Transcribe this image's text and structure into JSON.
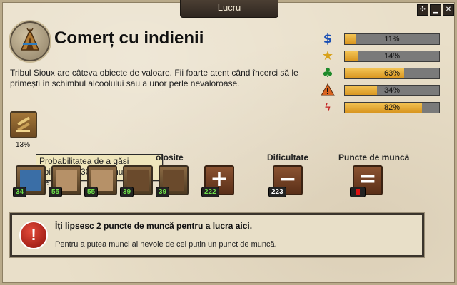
{
  "window": {
    "title": "Lucru",
    "buttons": [
      "✣",
      "▁",
      "✕"
    ]
  },
  "header": {
    "title": "Comerț cu indienii",
    "icon": "teepee-icon"
  },
  "description": "Tribul Sioux are câteva obiecte de valoare. Fii foarte atent când încerci să le primești în schimbul alcoolului sau a unor perle nevaloroase.",
  "stats": [
    {
      "name": "wages",
      "icon": "dollar-icon",
      "color": "#1a4fb4",
      "percent": "11%",
      "fill": 0.11
    },
    {
      "name": "experience",
      "icon": "star-icon",
      "color": "#d8a21c",
      "percent": "14%",
      "fill": 0.14
    },
    {
      "name": "luck",
      "icon": "clover-icon",
      "color": "#1e8a2a",
      "percent": "63%",
      "fill": 0.63
    },
    {
      "name": "danger",
      "icon": "warning-icon",
      "color": "#c2541c",
      "percent": "34%",
      "fill": 0.34
    },
    {
      "name": "motivation",
      "icon": "motivation-icon",
      "color": "#c21c1c",
      "percent": "82%",
      "fill": 0.82
    }
  ],
  "drop": {
    "cursor_label": "13%",
    "tooltip": "Probabilitatea de a găsi obiectul în 30 de minute este de 13%."
  },
  "columns": {
    "used": "olosite",
    "difficulty": "Dificultate",
    "work_points": "Puncte de muncă"
  },
  "skills": [
    {
      "icon": "trap-icon",
      "count": "34"
    },
    {
      "icon": "horse-icon",
      "count": "55"
    },
    {
      "icon": "horse-icon",
      "count": "55"
    },
    {
      "icon": "person-icon",
      "count": "39"
    },
    {
      "icon": "person-icon",
      "count": "39"
    }
  ],
  "sum": {
    "symbol": "+",
    "count": "222"
  },
  "difficulty": {
    "symbol": "−",
    "count": "223"
  },
  "work_points": {
    "symbol": "="
  },
  "warning": {
    "title": "Îți lipsesc 2 puncte de muncă pentru a lucra aici.",
    "text": "Pentru a putea munci ai nevoie de cel puțin un punct de muncă."
  }
}
